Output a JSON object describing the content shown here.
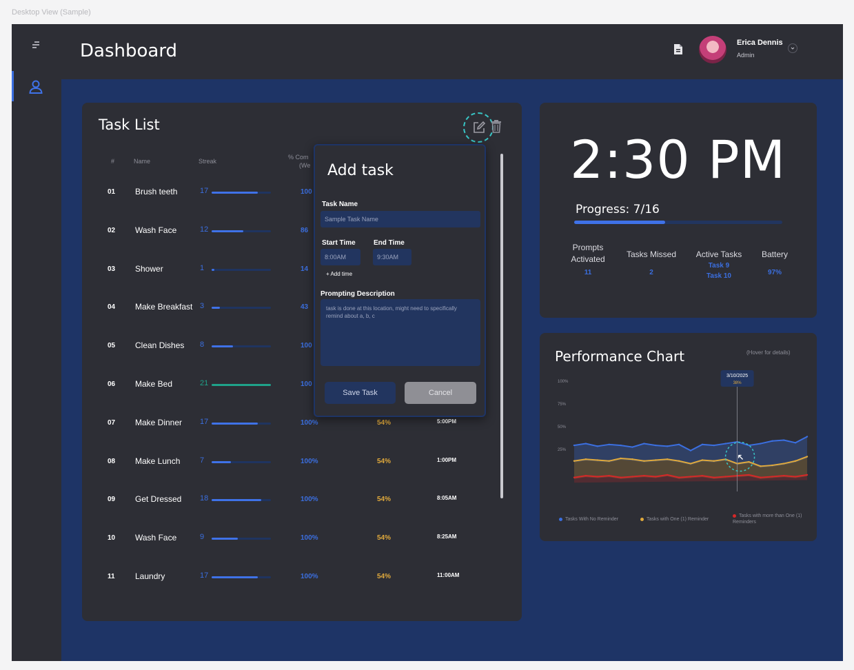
{
  "frame_label": "Desktop View (Sample)",
  "header": {
    "title": "Dashboard",
    "user": {
      "name": "Erica Dennis",
      "role": "Admin"
    }
  },
  "task_list": {
    "title": "Task List",
    "columns": {
      "index": "#",
      "name": "Name",
      "streak": "Streak",
      "completion_line1": "% Com",
      "completion_line2": "(We"
    },
    "rows": [
      {
        "num": "01",
        "name": "Brush teeth",
        "streak": "17",
        "streak_fraction": 0.78,
        "pct": "100",
        "pct2": "",
        "time": ""
      },
      {
        "num": "02",
        "name": "Wash Face",
        "streak": "12",
        "streak_fraction": 0.54,
        "pct": "86",
        "pct2": "",
        "time": ""
      },
      {
        "num": "03",
        "name": "Shower",
        "streak": "1",
        "streak_fraction": 0.05,
        "pct": "14",
        "pct2": "",
        "time": ""
      },
      {
        "num": "04",
        "name": "Make Breakfast",
        "streak": "3",
        "streak_fraction": 0.14,
        "pct": "43",
        "pct2": "",
        "time": ""
      },
      {
        "num": "05",
        "name": "Clean Dishes",
        "streak": "8",
        "streak_fraction": 0.36,
        "pct": "100",
        "pct2": "",
        "time": ""
      },
      {
        "num": "06",
        "name": "Make Bed",
        "streak": "21",
        "streak_fraction": 1.0,
        "pct": "100",
        "pct2": "",
        "time": ""
      },
      {
        "num": "07",
        "name": "Make Dinner",
        "streak": "17",
        "streak_fraction": 0.78,
        "pct": "100%",
        "pct2": "54%",
        "time": "5:00PM"
      },
      {
        "num": "08",
        "name": "Make Lunch",
        "streak": "7",
        "streak_fraction": 0.33,
        "pct": "100%",
        "pct2": "54%",
        "time": "1:00PM"
      },
      {
        "num": "09",
        "name": "Get Dressed",
        "streak": "18",
        "streak_fraction": 0.84,
        "pct": "100%",
        "pct2": "54%",
        "time": "8:05AM"
      },
      {
        "num": "10",
        "name": "Wash Face",
        "streak": "9",
        "streak_fraction": 0.44,
        "pct": "100%",
        "pct2": "54%",
        "time": "8:25AM"
      },
      {
        "num": "11",
        "name": "Laundry",
        "streak": "17",
        "streak_fraction": 0.78,
        "pct": "100%",
        "pct2": "54%",
        "time": "11:00AM"
      }
    ]
  },
  "add_task": {
    "title": "Add task",
    "task_name_label": "Task Name",
    "task_name_value": "Sample Task Name",
    "start_label": "Start Time",
    "start_value": "8:00AM",
    "end_label": "End Time",
    "end_value": "9:30AM",
    "add_time": "+ Add time",
    "desc_label": "Prompting Description",
    "desc_value": "task is done at this location, might need to specifically remind about a, b, c",
    "save": "Save Task",
    "cancel": "Cancel"
  },
  "status": {
    "time": "2:30 PM",
    "progress_label": "Progress: 7/16",
    "progress_fraction": 0.4375,
    "stats": [
      {
        "label": "Prompts Activated",
        "value": "11"
      },
      {
        "label": "Tasks Missed",
        "value": "2"
      },
      {
        "label": "Active Tasks",
        "value": "Task 9\nTask 10"
      },
      {
        "label": "Battery",
        "value": "97%"
      }
    ]
  },
  "performance": {
    "title": "Performance Chart",
    "hover_note": "(Hover for details)",
    "tooltip_date": "3/10/2025",
    "tooltip_value": "38%",
    "legend": [
      {
        "label": "Tasks With No Reminder",
        "color": "#3b6fe0"
      },
      {
        "label": "Tasks with One (1) Reminder",
        "color": "#e0a93c"
      },
      {
        "label": "Tasks with more than One (1) Reminders",
        "color": "#d62828"
      }
    ]
  },
  "chart_data": {
    "type": "area",
    "title": "Performance Chart",
    "y_ticks": [
      "100%",
      "75%",
      "50%",
      "25%"
    ],
    "ylim": [
      0,
      100
    ],
    "series": [
      {
        "name": "Tasks With No Reminder",
        "color": "#3b6fe0",
        "values": [
          42,
          44,
          41,
          43,
          42,
          40,
          44,
          42,
          41,
          43,
          36,
          43,
          42,
          44,
          46,
          42,
          44,
          47,
          48,
          45,
          52
        ]
      },
      {
        "name": "Tasks with One (1) Reminder",
        "color": "#e0a93c",
        "values": [
          24,
          26,
          25,
          24,
          27,
          26,
          24,
          25,
          26,
          24,
          21,
          25,
          24,
          26,
          21,
          23,
          18,
          19,
          21,
          24,
          29
        ]
      },
      {
        "name": "Tasks with more than One (1) Reminders",
        "color": "#d62828",
        "values": [
          5,
          7,
          6,
          7,
          5,
          6,
          7,
          6,
          8,
          5,
          6,
          7,
          5,
          6,
          7,
          8,
          5,
          6,
          7,
          6,
          8
        ]
      }
    ],
    "highlight_index": 14,
    "legend_position": "bottom"
  }
}
